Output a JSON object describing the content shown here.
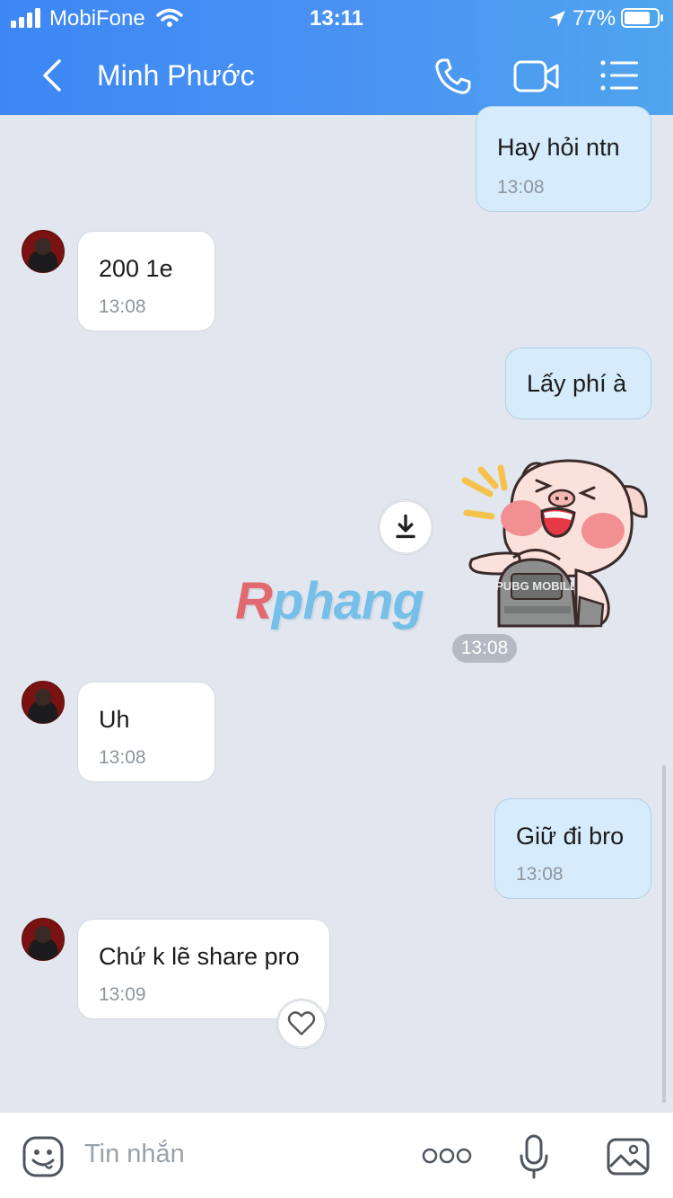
{
  "status_bar": {
    "carrier": "MobiFone",
    "time": "13:11",
    "battery_percent": "77%"
  },
  "header": {
    "contact_name": "Minh Phước"
  },
  "messages": [
    {
      "direction": "out",
      "text": "Hay hỏi ntn",
      "time": "13:08"
    },
    {
      "direction": "in",
      "text": "200 1e",
      "time": "13:08"
    },
    {
      "direction": "out",
      "text": "Lấy phí à",
      "time": ""
    },
    {
      "direction": "out",
      "type": "sticker",
      "sticker_text": "PUBG MOBILE",
      "time": "13:08"
    },
    {
      "direction": "in",
      "text": "Uh",
      "time": "13:08"
    },
    {
      "direction": "out",
      "text": "Giữ đi bro",
      "time": "13:08"
    },
    {
      "direction": "in",
      "text": "Chứ k lẽ share pro",
      "time": "13:09"
    }
  ],
  "watermark": {
    "text_first": "R",
    "text_rest": "phang"
  },
  "composer": {
    "placeholder": "Tin nhắn"
  },
  "colors": {
    "header_blue": "#3d87f5",
    "outgoing_bubble": "#d6ebfb",
    "incoming_bubble": "#ffffff",
    "background": "#e2e7ef"
  },
  "icons": [
    "back-icon",
    "phone-icon",
    "video-call-icon",
    "menu-icon",
    "download-icon",
    "heart-icon",
    "emoji-icon",
    "more-icon",
    "mic-icon",
    "image-icon"
  ]
}
